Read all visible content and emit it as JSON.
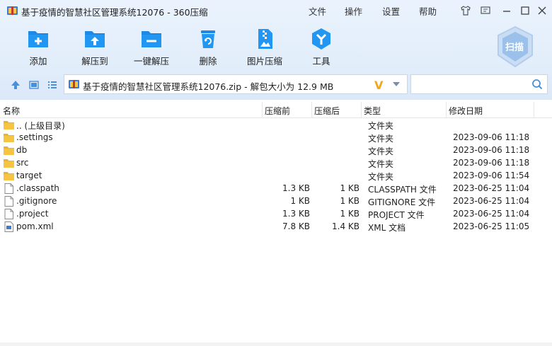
{
  "window": {
    "title": "基于疫情的智慧社区管理系统12076 - 360压缩"
  },
  "menu": {
    "file": "文件",
    "operate": "操作",
    "settings": "设置",
    "help": "帮助"
  },
  "toolbar": [
    {
      "label": "添加",
      "icon": "add-folder-icon"
    },
    {
      "label": "解压到",
      "icon": "extract-to-icon"
    },
    {
      "label": "一键解压",
      "icon": "one-click-extract-icon"
    },
    {
      "label": "删除",
      "icon": "recycle-bin-icon"
    },
    {
      "label": "图片压缩",
      "icon": "image-compress-icon"
    },
    {
      "label": "工具",
      "icon": "tools-icon"
    }
  ],
  "scan": {
    "label": "扫描"
  },
  "address": {
    "path": "基于疫情的智慧社区管理系统12076.zip - 解包大小为 12.9 MB",
    "logo": "V"
  },
  "search": {
    "placeholder": "",
    "value": ""
  },
  "columns": {
    "name": "名称",
    "before": "压缩前",
    "after": "压缩后",
    "type": "类型",
    "modified": "修改日期"
  },
  "files": [
    {
      "name": ".. (上级目录)",
      "before": "",
      "after": "",
      "type": "文件夹",
      "modified": "",
      "icon": "folder-icon"
    },
    {
      "name": ".settings",
      "before": "",
      "after": "",
      "type": "文件夹",
      "modified": "2023-09-06 11:18",
      "icon": "folder-icon"
    },
    {
      "name": "db",
      "before": "",
      "after": "",
      "type": "文件夹",
      "modified": "2023-09-06 11:18",
      "icon": "folder-icon"
    },
    {
      "name": "src",
      "before": "",
      "after": "",
      "type": "文件夹",
      "modified": "2023-09-06 11:18",
      "icon": "folder-icon"
    },
    {
      "name": "target",
      "before": "",
      "after": "",
      "type": "文件夹",
      "modified": "2023-09-06 11:54",
      "icon": "folder-icon"
    },
    {
      "name": ".classpath",
      "before": "1.3 KB",
      "after": "1 KB",
      "type": "CLASSPATH 文件",
      "modified": "2023-06-25 11:04",
      "icon": "file-icon"
    },
    {
      "name": ".gitignore",
      "before": "1 KB",
      "after": "1 KB",
      "type": "GITIGNORE 文件",
      "modified": "2023-06-25 11:04",
      "icon": "file-icon"
    },
    {
      "name": ".project",
      "before": "1.3 KB",
      "after": "1 KB",
      "type": "PROJECT 文件",
      "modified": "2023-06-25 11:04",
      "icon": "file-icon"
    },
    {
      "name": "pom.xml",
      "before": "7.8 KB",
      "after": "1.4 KB",
      "type": "XML 文档",
      "modified": "2023-06-25 11:05",
      "icon": "xml-file-icon"
    }
  ]
}
